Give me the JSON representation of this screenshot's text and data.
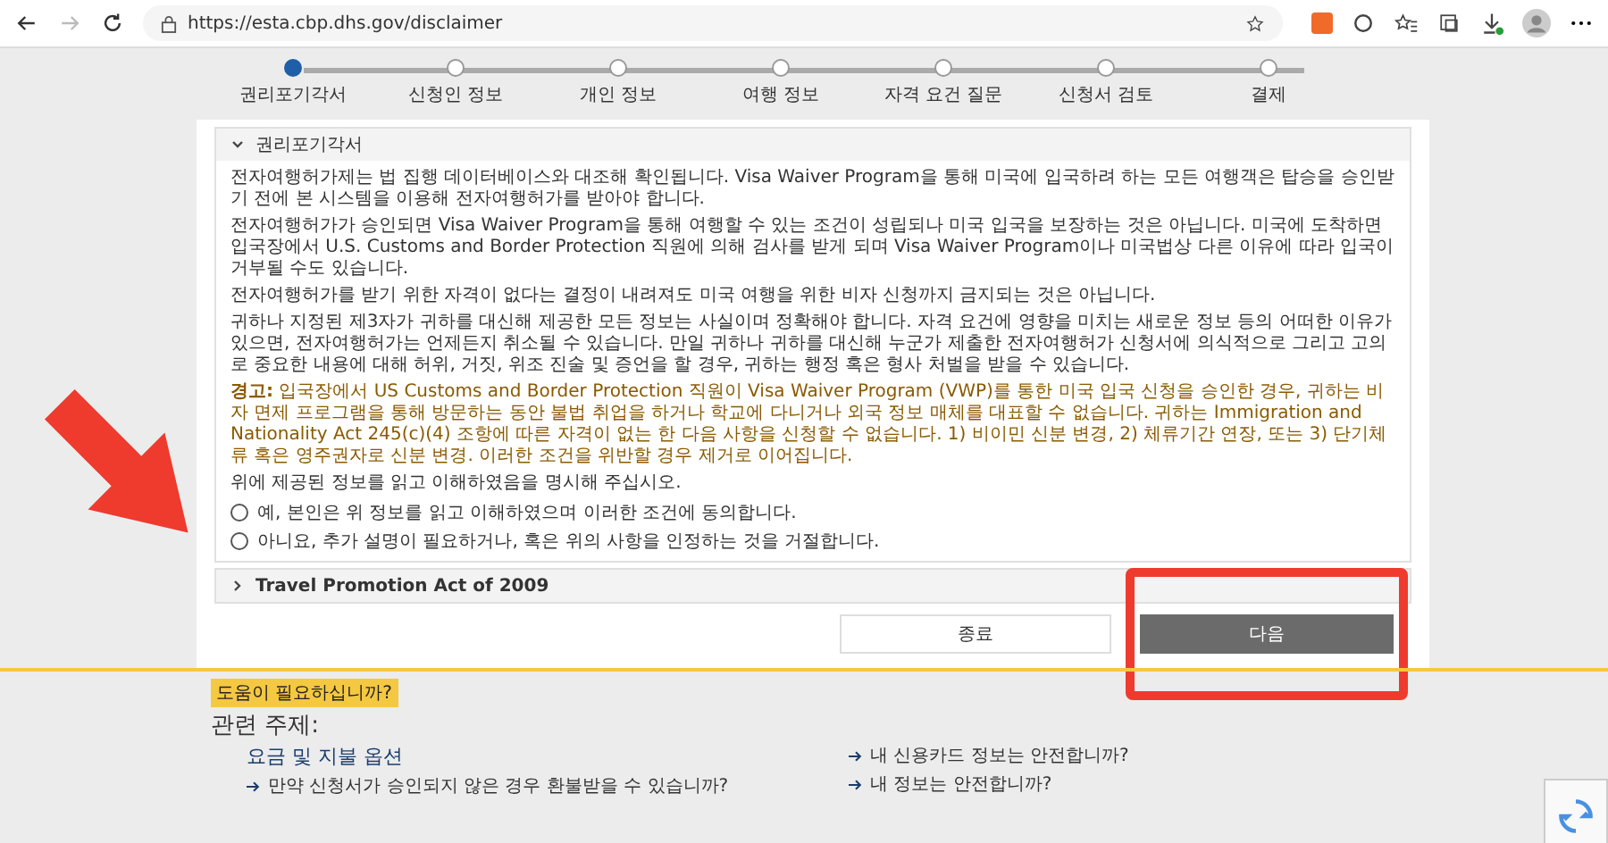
{
  "browser": {
    "url": "https://esta.cbp.dhs.gov/disclaimer"
  },
  "steps": [
    {
      "label": "권리포기각서",
      "selected": true
    },
    {
      "label": "신청인 정보",
      "selected": false
    },
    {
      "label": "개인 정보",
      "selected": false
    },
    {
      "label": "여행 정보",
      "selected": false
    },
    {
      "label": "자격 요건 질문",
      "selected": false
    },
    {
      "label": "신청서 검토",
      "selected": false
    },
    {
      "label": "결제",
      "selected": false
    }
  ],
  "sections": [
    {
      "title": "권리포기각서",
      "expanded": true,
      "paragraphs": [
        {
          "kind": "normal",
          "text": "전자여행허가제는 법 집행 데이터베이스와 대조해 확인됩니다. Visa Waiver Program을 통해 미국에 입국하려 하는 모든 여행객은 탑승을 승인받기 전에 본 시스템을 이용해 전자여행허가를 받아야 합니다."
        },
        {
          "kind": "normal",
          "text": "전자여행허가가 승인되면 Visa Waiver Program을 통해 여행할 수 있는 조건이 성립되나 미국 입국을 보장하는 것은 아닙니다. 미국에 도착하면 입국장에서 U.S. Customs and Border Protection 직원에 의해 검사를 받게 되며 Visa Waiver Program이나 미국법상 다른 이유에 따라 입국이 거부될 수도 있습니다."
        },
        {
          "kind": "normal",
          "text": "전자여행허가를 받기 위한 자격이 없다는 결정이 내려져도 미국 여행을 위한 비자 신청까지 금지되는 것은 아닙니다."
        },
        {
          "kind": "normal",
          "text": "귀하나 지정된 제3자가 귀하를 대신해 제공한 모든 정보는 사실이며 정확해야 합니다. 자격 요건에 영향을 미치는 새로운 정보 등의 어떠한 이유가 있으면, 전자여행허가는 언제든지 취소될 수 있습니다. 만일 귀하나 귀하를 대신해 누군가 제출한 전자여행허가 신청서에 의식적으로 그리고 고의로 중요한 내용에 대해 허위, 거짓, 위조 진술 및 증언을 할 경우, 귀하는 행정 혹은 형사 처벌을 받을 수 있습니다."
        },
        {
          "kind": "warning",
          "text": "**경고:** 입국장에서 US Customs and Border Protection 직원이 Visa Waiver Program (VWP)를 통한 미국 입국 신청을 승인한 경우, 귀하는 비자 면제 프로그램을 통해 방문하는 동안 불법 취업을 하거나 학교에 다니거나 외국 정보 매체를 대표할 수 없습니다. 귀하는 Immigration and Nationality Act 245(c)(4) 조항에 따른 자격이 없는 한 다음 사항을 신청할 수 없습니다. 1) 비이민 신분 변경, 2) 체류기간 연장, 또는 3) 단기체류 혹은 영주권자로 신분 변경. 이러한 조건을 위반할 경우 제거로 이어집니다."
        },
        {
          "kind": "normal",
          "text": "위에 제공된 정보를 읽고 이해하였음을 명시해 주십시오."
        }
      ],
      "options": [
        {
          "label": "예, 본인은 위 정보를 읽고 이해하였으며 이러한 조건에 동의합니다.",
          "selected": false
        },
        {
          "label": "아니요, 추가 설명이 필요하거나, 혹은 위의 사항을 인정하는 것을 거절합니다.",
          "selected": false
        }
      ]
    },
    {
      "title": "Travel Promotion Act of 2009",
      "expanded": false
    }
  ],
  "buttons": [
    {
      "label": "종료",
      "kind": "secondary"
    },
    {
      "label": "다음",
      "kind": "primary"
    }
  ],
  "footer": {
    "help": "도움이 필요하십니까?",
    "heading": "관련 주제:",
    "left": {
      "title": "요금 및 지불 옵션",
      "links": [
        "만약 신청서가 승인되지 않은 경우 환불받을 수 있습니까?"
      ]
    },
    "right": {
      "links": [
        "내 신용카드 정보는 안전합니까?",
        "내 정보는 안전합니까?"
      ]
    }
  }
}
